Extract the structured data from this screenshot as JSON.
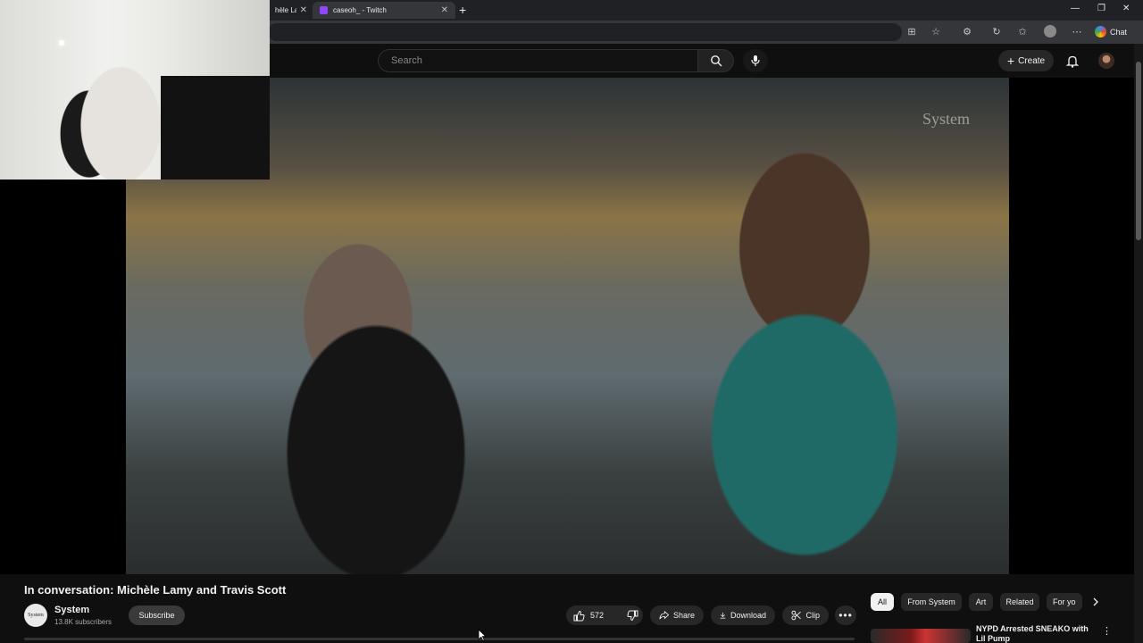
{
  "browser": {
    "tabs": [
      {
        "label": "hèle Lam",
        "active": false
      },
      {
        "label": "caseoh_ - Twitch",
        "active": true
      }
    ],
    "new_tab_icon": "plus-icon",
    "chat_label": "Chat"
  },
  "masthead": {
    "search_placeholder": "Search",
    "create_label": "Create"
  },
  "video": {
    "watermark": "System"
  },
  "below_video": {
    "title": "In conversation: Michèle Lamy and Travis Scott",
    "channel": {
      "name": "System",
      "subscribers": "13.8K subscribers",
      "avatar_text": "System"
    },
    "subscribe_label": "Subscribe",
    "actions": {
      "like_count": "572",
      "share_label": "Share",
      "download_label": "Download",
      "clip_label": "Clip"
    }
  },
  "sidebar": {
    "chips": [
      "All",
      "From System",
      "Art",
      "Related",
      "For yo"
    ],
    "active_chip": "All",
    "recommendation": {
      "title": "NYPD Arrested SNEAKO with Lil Pump"
    }
  },
  "colors": {
    "background": "#0f0f0f",
    "twitch_purple": "#9146ff",
    "pill_bg": "#272727"
  }
}
